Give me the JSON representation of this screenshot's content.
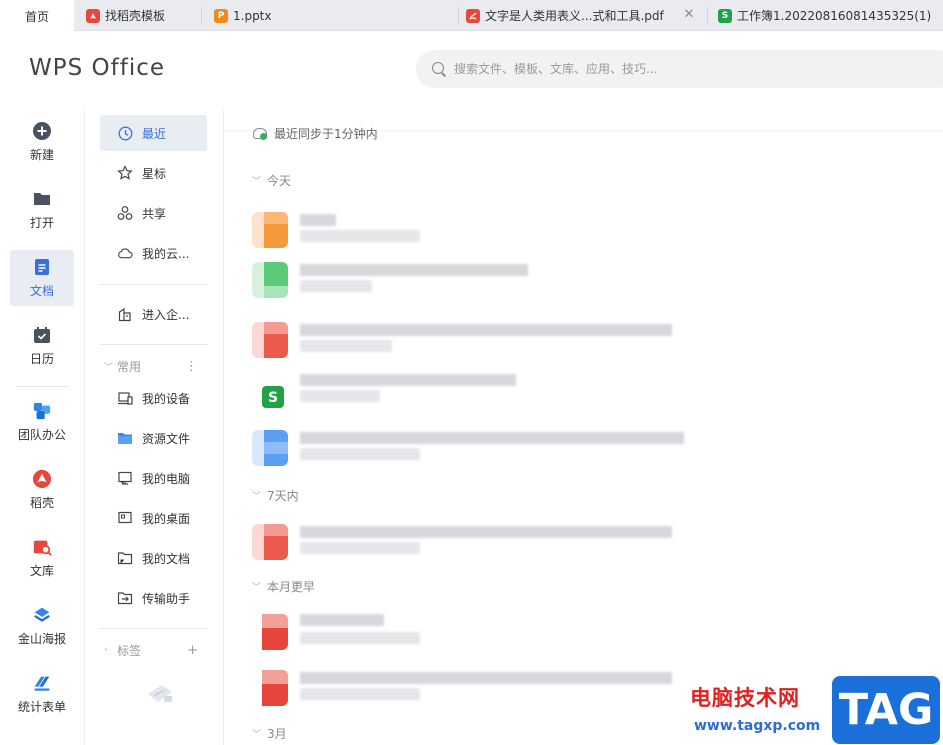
{
  "tabs": [
    {
      "label": "首页",
      "icon": "home",
      "active": true
    },
    {
      "label": "找稻壳模板",
      "icon": "docer-icon",
      "color": "#e8473d"
    },
    {
      "label": "1.pptx",
      "icon": "ppt-icon",
      "color": "#f08a1c"
    },
    {
      "label": "文字是人类用表义...式和工具.pdf",
      "icon": "pdf-icon",
      "color": "#e8473d"
    },
    {
      "label": "工作簿1.20220816081435325(1)",
      "icon": "sheet-icon",
      "color": "#1fa346"
    }
  ],
  "header": {
    "logo": "WPS Office",
    "search_placeholder": "搜索文件、模板、文库、应用、技巧..."
  },
  "rail": [
    {
      "label": "新建",
      "icon": "plus-circle-icon"
    },
    {
      "label": "打开",
      "icon": "folder-icon"
    },
    {
      "label": "文档",
      "icon": "document-icon",
      "active": true
    },
    {
      "label": "日历",
      "icon": "calendar-icon"
    },
    {
      "label": "团队办公",
      "icon": "team-office-icon"
    },
    {
      "label": "稻壳",
      "icon": "docer-icon"
    },
    {
      "label": "文库",
      "icon": "library-icon"
    },
    {
      "label": "金山海报",
      "icon": "poster-icon"
    },
    {
      "label": "统计表单",
      "icon": "form-icon"
    }
  ],
  "nav": {
    "recent": "最近",
    "starred": "星标",
    "shared": "共享",
    "cloud": "我的云...",
    "enterprise": "进入企...",
    "common_group": "常用",
    "my_device": "我的设备",
    "resource_files": "资源文件",
    "my_computer": "我的电脑",
    "my_desktop": "我的桌面",
    "my_documents": "我的文档",
    "transfer_helper": "传输助手",
    "tags_group": "标签"
  },
  "main": {
    "sync_status": "最近同步于1分钟内",
    "sections": {
      "today": "今天",
      "seven_days": "7天内",
      "earlier_month": "本月更早",
      "march": "3月"
    }
  },
  "watermark": {
    "site_name": "电脑技术网",
    "url": "www.tagxp.com",
    "badge": "TAG"
  },
  "colors": {
    "accent": "#3a6fd8",
    "active_bg": "#e8ecf3",
    "wps_red": "#e8473d",
    "sheet_green": "#1fa346",
    "ppt_orange": "#f08a1c"
  }
}
